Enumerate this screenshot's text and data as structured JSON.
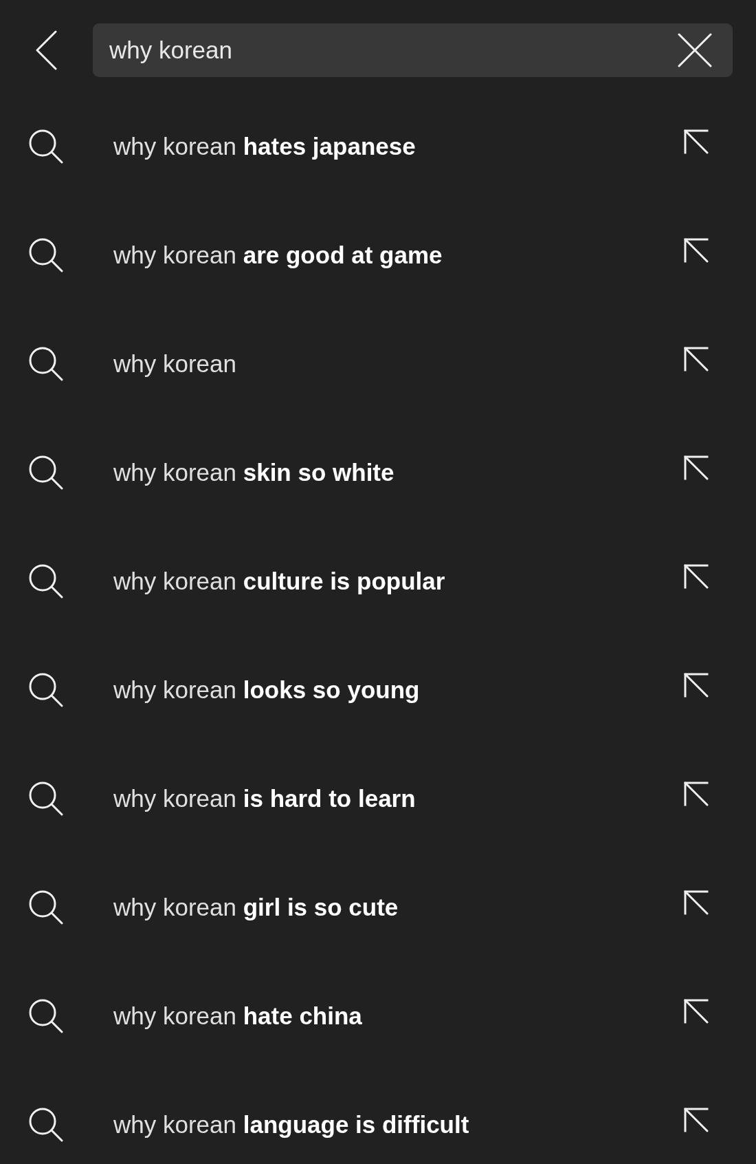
{
  "search": {
    "value": "why korean"
  },
  "suggestions": [
    {
      "text": "why korean **hates japanese**"
    },
    {
      "text": "why korean **are good at game**"
    },
    {
      "text": "why korean"
    },
    {
      "text": "why korean **skin so white**"
    },
    {
      "text": "why korean **culture is popular**"
    },
    {
      "text": "why korean **looks so young**"
    },
    {
      "text": "why korean **is hard to learn**"
    },
    {
      "text": "why korean **girl is so cute**"
    },
    {
      "text": "why korean **hate china**"
    },
    {
      "text": "why korean **language is difficult**"
    }
  ]
}
